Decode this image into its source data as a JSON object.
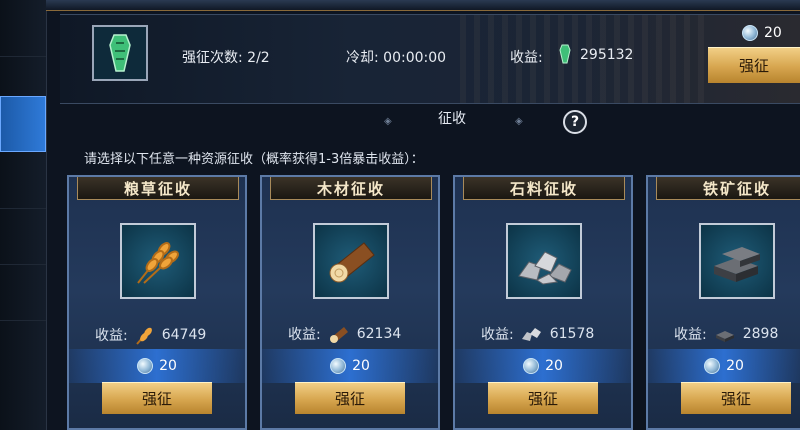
{
  "header": {
    "levy_count_label": "强征次数: 2/2",
    "cooldown_label": "冷却: 00:00:00",
    "income_label": "收益:",
    "income_value": "295132",
    "cost_value": "20",
    "levy_button": "强征"
  },
  "section": {
    "title": "征收",
    "help": "?",
    "instruction": "请选择以下任意一种资源征收（概率获得1-3倍暴击收益）："
  },
  "cards": [
    {
      "title": "粮草征收",
      "yield_label": "收益:",
      "yield_value": "64749",
      "cost": "20",
      "button": "强征"
    },
    {
      "title": "木材征收",
      "yield_label": "收益:",
      "yield_value": "62134",
      "cost": "20",
      "button": "强征"
    },
    {
      "title": "石料征收",
      "yield_label": "收益:",
      "yield_value": "61578",
      "cost": "20",
      "button": "强征"
    },
    {
      "title": "铁矿征收",
      "yield_label": "收益:",
      "yield_value": "2898",
      "cost": "20",
      "button": "强征"
    }
  ]
}
